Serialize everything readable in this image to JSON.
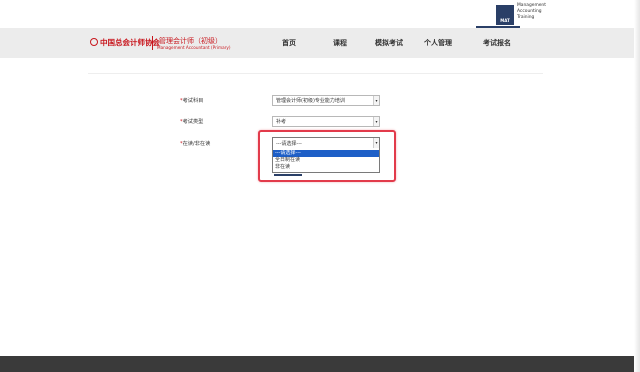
{
  "mat": {
    "badge": "MAT",
    "lines": [
      "Management",
      "Accounting",
      "Training"
    ]
  },
  "brand": {
    "cn_name": "中国总会计师协会",
    "title": "管理会计师（初级）",
    "subtitle": "Management Accountant (Primary)"
  },
  "nav": {
    "items": [
      {
        "label": "首页"
      },
      {
        "label": "课程"
      },
      {
        "label": "模拟考试"
      },
      {
        "label": "个人管理"
      },
      {
        "label": "考试报名"
      }
    ],
    "active": "考试报名"
  },
  "form": {
    "subject": {
      "label": "考试科目",
      "value": "管理会计师(初级)专业能力培训"
    },
    "category": {
      "label": "考试类型",
      "value": "补考"
    },
    "status": {
      "label": "在读/非在读",
      "value": "---请选择---",
      "options": [
        "---请选择---",
        "全日制在读",
        "非在读"
      ],
      "highlighted": "---请选择---"
    }
  },
  "colors": {
    "brand_red": "#c8161d",
    "nav_blue": "#2a3f67",
    "highlight_red": "#e23b4b",
    "selection_blue": "#1e5fc7"
  }
}
